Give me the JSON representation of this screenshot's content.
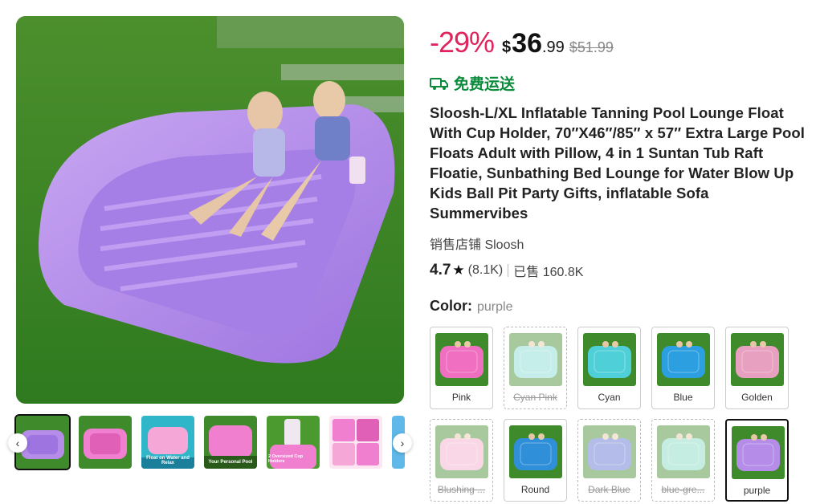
{
  "price": {
    "discount": "-29%",
    "currency": "$",
    "integer": "36",
    "decimal": ".99",
    "original": "$51.99"
  },
  "shipping": {
    "icon": "truck-icon",
    "label": "免费运送",
    "color": "#0a8a3a"
  },
  "title": "Sloosh-L/XL Inflatable Tanning Pool Lounge Float With Cup Holder, 70″X46″/85″ x 57″ Extra Large Pool Floats Adult with Pillow, 4 in 1 Suntan Tub Raft Floatie, Sunbathing Bed Lounge for Water Blow Up Kids Ball Pit Party Gifts, inflatable Sofa Summervibes",
  "store": "销售店铺 Sloosh",
  "rating": {
    "score": "4.7",
    "reviews": "(8.1K)",
    "sold": "已售 160.8K"
  },
  "color": {
    "label": "Color:",
    "selected": "purple"
  },
  "gallery": {
    "prev_icon": "chevron-left-icon",
    "next_icon": "chevron-right-icon",
    "selected_index": 0,
    "thumb_captions": [
      "",
      "",
      "Float on Water and Relax",
      "Your Personal Pool",
      "2 Oversized Cup Holders",
      "",
      ""
    ]
  },
  "colors": [
    {
      "name": "Pink",
      "available": true,
      "hue": "#f06fc0"
    },
    {
      "name": "Cyan Pink",
      "available": false,
      "hue": "#7fd8d0"
    },
    {
      "name": "Cyan",
      "available": true,
      "hue": "#4fcfd8"
    },
    {
      "name": "Blue",
      "available": true,
      "hue": "#2b9fe0"
    },
    {
      "name": "Golden",
      "available": true,
      "hue": "#e8a0c0"
    },
    {
      "name": "Blushing ...",
      "available": false,
      "hue": "#f5a8c8"
    },
    {
      "name": "Round",
      "available": true,
      "hue": "#2f8fd8"
    },
    {
      "name": "Dark Blue",
      "available": false,
      "hue": "#5a6fd0"
    },
    {
      "name": "blue-gre...",
      "available": false,
      "hue": "#80d8c0"
    },
    {
      "name": "purple",
      "available": true,
      "hue": "#b58de8"
    }
  ],
  "accent_colors": {
    "discount": "#e0245e",
    "selected_border": "#111111"
  }
}
